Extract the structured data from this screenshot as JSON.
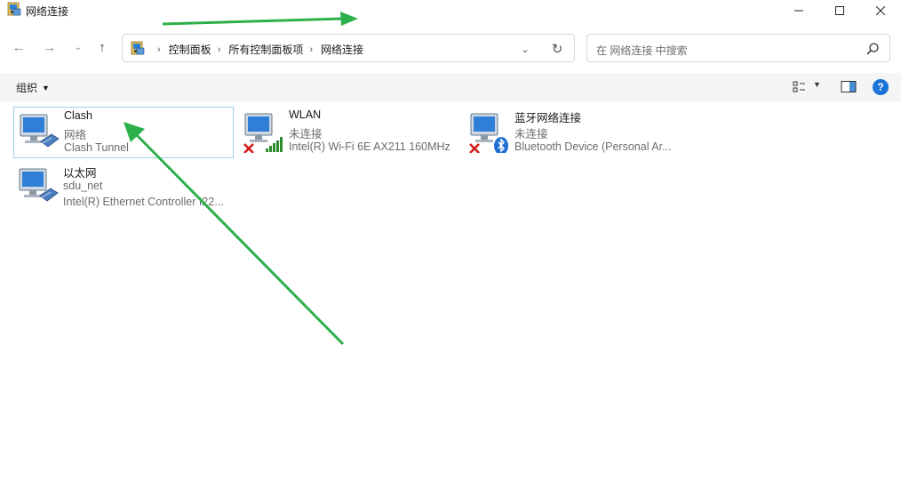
{
  "window": {
    "title": "网络连接"
  },
  "nav": {
    "breadcrumbs": [
      "控制面板",
      "所有控制面板项",
      "网络连接"
    ]
  },
  "search": {
    "placeholder": "在 网络连接 中搜索"
  },
  "commandbar": {
    "organize_label": "组织",
    "help_label": "?"
  },
  "connections": [
    {
      "name": "Clash",
      "status": "网络",
      "device": "Clash Tunnel",
      "selected": true,
      "badge": "none"
    },
    {
      "name": "WLAN",
      "status": "未连接",
      "device": "Intel(R) Wi-Fi 6E AX211 160MHz",
      "selected": false,
      "badge": "wifi-disconnected"
    },
    {
      "name": "蓝牙网络连接",
      "status": "未连接",
      "device": "Bluetooth Device (Personal Ar...",
      "selected": false,
      "badge": "bluetooth-disconnected"
    },
    {
      "name": "以太网",
      "status": "sdu_net",
      "device": "Intel(R) Ethernet Controller I22...",
      "selected": false,
      "badge": "cable"
    }
  ],
  "colors": {
    "annotation_arrow": "#2db04b",
    "selection_border": "#99d1e6",
    "help_blue": "#1a73d8"
  }
}
